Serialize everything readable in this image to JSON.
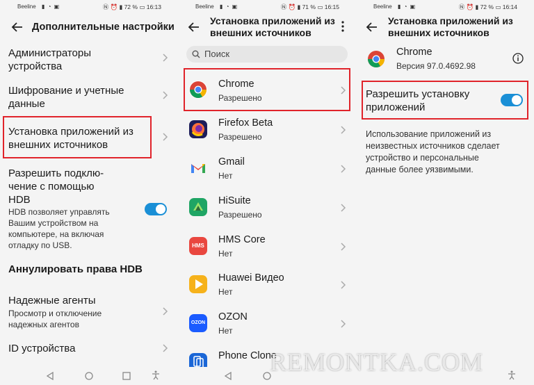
{
  "status_bars": [
    {
      "carrier": "Beeline",
      "battery": "72 %",
      "time": "16:13"
    },
    {
      "carrier": "Beeline",
      "battery": "71 %",
      "time": "16:15"
    },
    {
      "carrier": "Beeline",
      "battery": "72 %",
      "time": "16:14"
    }
  ],
  "screen1": {
    "title": "Дополнительные настройки",
    "items": [
      {
        "line1": "Администраторы",
        "line2": "устройства"
      },
      {
        "line1": "Шифрование и учетные",
        "line2": "данные"
      },
      {
        "line1": "Установка приложений из",
        "line2": "внешних источников"
      }
    ],
    "hdb": {
      "line1": "Разрешить подклю-",
      "line2": "чение с помощью",
      "line3": "HDB",
      "desc1": "HDB позволяет управлять",
      "desc2": "Вашим устройством на",
      "desc3": "компьютере, на включая",
      "desc4": "отладку по USB.",
      "enabled": true
    },
    "revoke": "Аннулировать права HDB",
    "trusted": {
      "title": "Надежные агенты",
      "sub1": "Просмотр и отключение",
      "sub2": "надежных агентов"
    },
    "device_id": "ID устройства"
  },
  "screen2": {
    "title1": "Установка приложений из",
    "title2": "внешних источников",
    "search_placeholder": "Поиск",
    "apps": [
      {
        "name": "Chrome",
        "status": "Разрешено"
      },
      {
        "name": "Firefox Beta",
        "status": "Разрешено"
      },
      {
        "name": "Gmail",
        "status": "Нет"
      },
      {
        "name": "HiSuite",
        "status": "Разрешено"
      },
      {
        "name": "HMS Core",
        "status": "Нет",
        "icon_text": "HMS"
      },
      {
        "name": "Huawei Видео",
        "status": "Нет"
      },
      {
        "name": "OZON",
        "status": "Нет",
        "icon_text": "OZON"
      },
      {
        "name": "Phone Clone",
        "status": ""
      }
    ]
  },
  "screen3": {
    "title1": "Установка приложений из",
    "title2": "внешних источников",
    "app_name": "Chrome",
    "app_version": "Версия 97.0.4692.98",
    "allow1": "Разрешить установку",
    "allow2": "приложений",
    "allow_enabled": true,
    "desc1": "Использование приложений из",
    "desc2": "неизвестных источников сделает",
    "desc3": "устройство и персональные",
    "desc4": "данные более уязвимыми."
  },
  "watermark": "REMONTKA.COM",
  "colors": {
    "accent": "#1a8fd6",
    "highlight_box": "#e0232a",
    "panel_bg": "#f4f4f4"
  }
}
